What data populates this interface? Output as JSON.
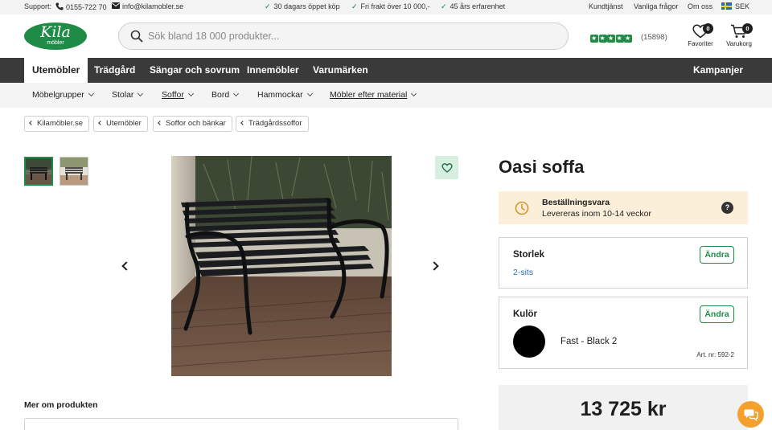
{
  "topbar": {
    "support_label": "Support:",
    "phone": "0155-722 70",
    "email": "info@kilamobler.se",
    "usps": [
      "30 dagars öppet köp",
      "Fri frakt över 10 000,-",
      "45 års erfarenhet"
    ],
    "links": [
      "Kundtjänst",
      "Vanliga frågor",
      "Om oss"
    ],
    "currency": "SEK"
  },
  "header": {
    "logo_main": "Kila",
    "logo_sub": "möbler",
    "search_placeholder": "Sök bland 18 000 produkter...",
    "rating_stars": 5,
    "review_count": "(15898)",
    "favorites_label": "Favoriter",
    "favorites_count": "0",
    "cart_label": "Varukorg",
    "cart_count": "0"
  },
  "main_nav": {
    "items": [
      "Utemöbler",
      "Trädgård",
      "Sängar och sovrum",
      "Innemöbler",
      "Varumärken"
    ],
    "active": "Utemöbler",
    "campaigns": "Kampanjer"
  },
  "sub_nav": {
    "items": [
      "Möbelgrupper",
      "Stolar",
      "Soffor",
      "Bord",
      "Hammockar",
      "Möbler efter material"
    ],
    "active": "Soffor"
  },
  "breadcrumbs": [
    "Kilamöbler.se",
    "Utemöbler",
    "Soffor och bänkar",
    "Trädgårdssoffor"
  ],
  "product": {
    "title": "Oasi soffa",
    "delivery_title": "Beställningsvara",
    "delivery_text": "Levereras inom 10-14 veckor",
    "help_icon": "?",
    "size_label": "Storlek",
    "size_value": "2-sits",
    "color_label": "Kulör",
    "color_value": "Fast - Black 2",
    "color_swatch": "#000000",
    "change_label": "Ändra",
    "art_nr": "Art. nr: 592-2",
    "price": "13 725 kr",
    "more_heading": "Mer om produkten"
  },
  "colors": {
    "brand_green": "#1e8b46",
    "nav_dark": "#3a3a3a",
    "notice_bg": "#fbefd9",
    "link_blue": "#2b6fb8",
    "chat_orange": "#f5a02c"
  }
}
